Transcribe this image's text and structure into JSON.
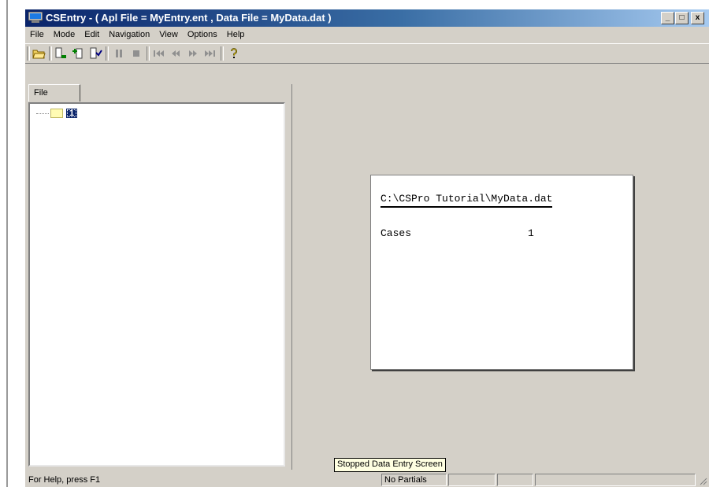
{
  "window": {
    "title": "CSEntry - ( Apl File = MyEntry.ent , Data File = MyData.dat )",
    "caption_buttons": [
      "_",
      "□",
      "x"
    ]
  },
  "menu": [
    "File",
    "Mode",
    "Edit",
    "Navigation",
    "View",
    "Options",
    "Help"
  ],
  "toolbar": {
    "icons": [
      "open-icon",
      "add-case-icon",
      "modify-case-icon",
      "verify-case-icon",
      "pause-icon",
      "stop-icon",
      "first-case-icon",
      "previous-case-icon",
      "next-case-icon",
      "last-case-icon",
      "help-icon"
    ]
  },
  "left_panel": {
    "tab": "File",
    "tree": [
      {
        "label": "1"
      }
    ]
  },
  "summary": {
    "path": "C:\\CSPro Tutorial\\MyData.dat",
    "cases_label": "Cases",
    "cases_value": "1"
  },
  "tooltip": "Stopped Data Entry Screen",
  "statusbar": {
    "help_text": "For Help, press F1",
    "partials": "No Partials"
  },
  "colors": {
    "titlebar_start": "#0a246a",
    "titlebar_end": "#a6caf0",
    "window_face": "#d4d0c8",
    "tooltip_bg": "#ffffe1"
  }
}
